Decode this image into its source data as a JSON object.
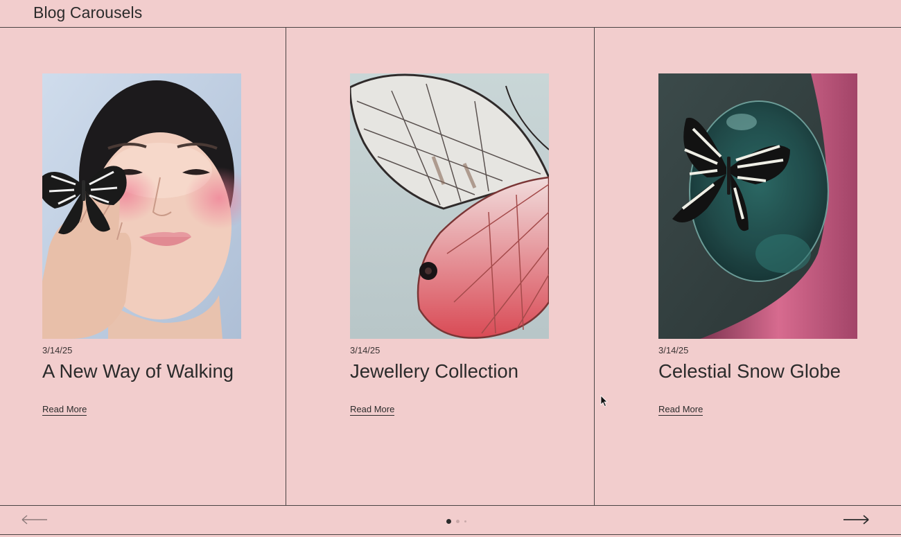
{
  "header": {
    "title": "Blog Carousels"
  },
  "posts": [
    {
      "date": "3/14/25",
      "title": "A New Way of Walking",
      "link_label": "Read More"
    },
    {
      "date": "3/14/25",
      "title": "Jewellery Collection",
      "link_label": "Read More"
    },
    {
      "date": "3/14/25",
      "title": "Celestial Snow Globe",
      "link_label": "Read More"
    }
  ],
  "carousel": {
    "prev_icon": "arrow-left-icon",
    "next_icon": "arrow-right-icon",
    "page_count": 3,
    "active_page": 1
  },
  "colors": {
    "background": "#f2cdcd",
    "text": "#2b2b2b",
    "divider": "#4a4343"
  }
}
